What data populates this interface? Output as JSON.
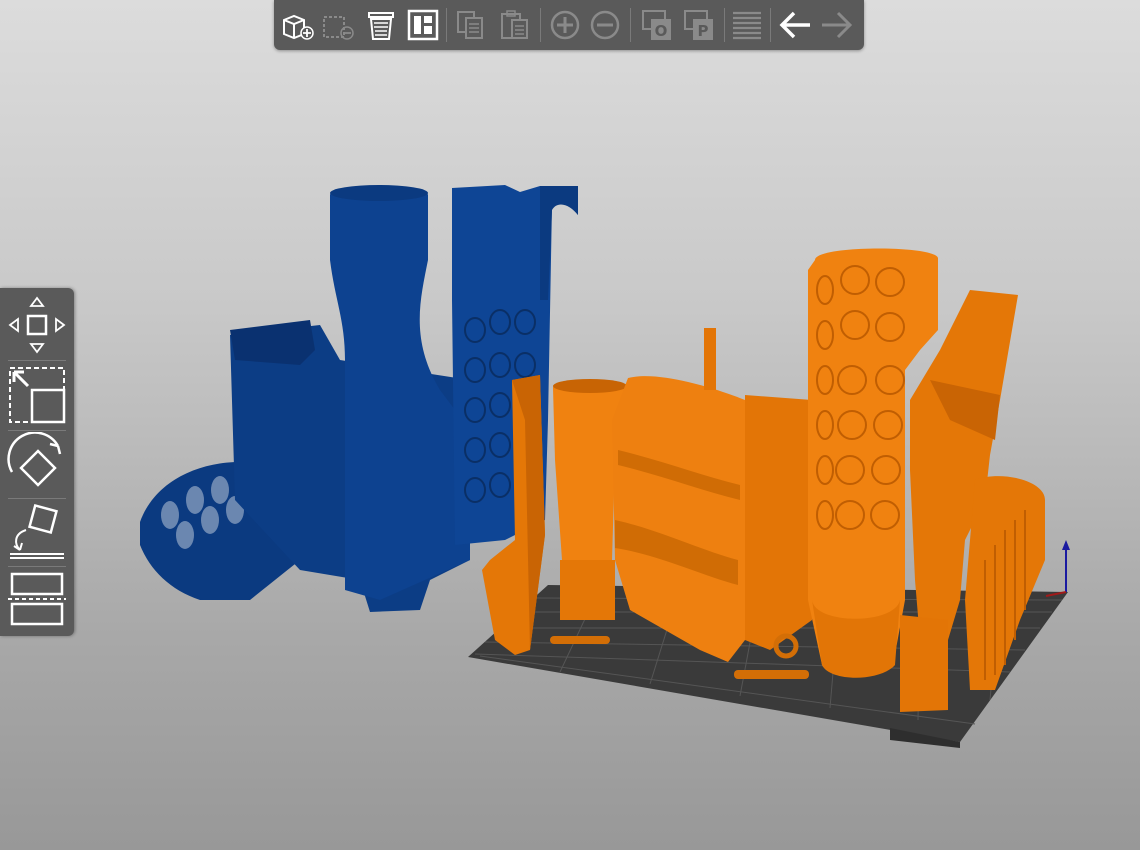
{
  "app": {
    "view": "3d-plater"
  },
  "colors": {
    "toolbar_bg": "#5a5a5a",
    "icon_active": "#ffffff",
    "icon_disabled": "#8a8a8a",
    "blue_part": "#0b3a80",
    "orange_part": "#e47707",
    "bed": "#3a3a3a"
  },
  "top_toolbar": {
    "items": [
      {
        "icon": "add-object-icon",
        "enabled": true
      },
      {
        "icon": "delete-object-icon",
        "enabled": false
      },
      {
        "icon": "delete-all-icon",
        "enabled": true
      },
      {
        "icon": "arrange-icon",
        "enabled": true
      },
      {
        "icon": "copy-icon",
        "enabled": false
      },
      {
        "icon": "paste-icon",
        "enabled": false
      },
      {
        "icon": "add-instance-icon",
        "enabled": false
      },
      {
        "icon": "remove-instance-icon",
        "enabled": false
      },
      {
        "icon": "split-to-objects-icon",
        "enabled": false
      },
      {
        "icon": "split-to-parts-icon",
        "enabled": false
      },
      {
        "icon": "layers-editing-icon",
        "enabled": false
      },
      {
        "icon": "undo-icon",
        "enabled": true
      },
      {
        "icon": "redo-icon",
        "enabled": false
      }
    ]
  },
  "left_toolbar": {
    "items": [
      {
        "icon": "move-icon"
      },
      {
        "icon": "scale-icon"
      },
      {
        "icon": "rotate-icon"
      },
      {
        "icon": "place-on-face-icon"
      },
      {
        "icon": "cut-icon"
      }
    ]
  }
}
